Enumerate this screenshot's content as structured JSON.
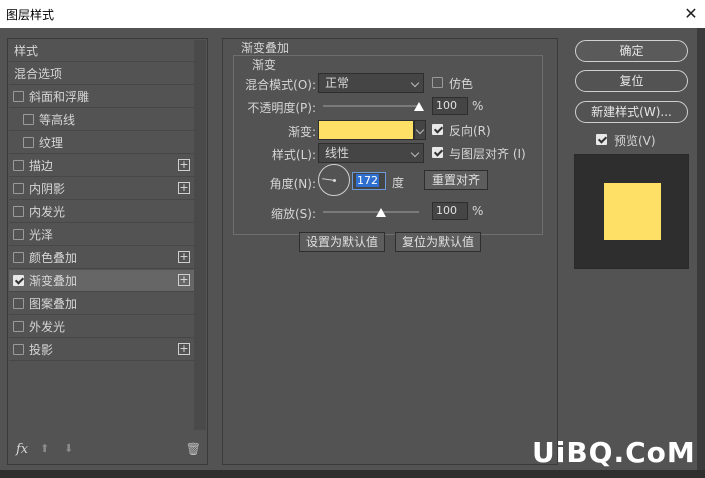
{
  "window": {
    "title": "图层样式",
    "close": "✕"
  },
  "styles_list": {
    "items": [
      {
        "label": "样式",
        "checkbox": false,
        "checked": false,
        "indent": 0,
        "plus": false,
        "selected": false
      },
      {
        "label": "混合选项",
        "checkbox": false,
        "checked": false,
        "indent": 0,
        "plus": false,
        "selected": false
      },
      {
        "label": "斜面和浮雕",
        "checkbox": true,
        "checked": false,
        "indent": 0,
        "plus": false,
        "selected": false
      },
      {
        "label": "等高线",
        "checkbox": true,
        "checked": false,
        "indent": 1,
        "plus": false,
        "selected": false
      },
      {
        "label": "纹理",
        "checkbox": true,
        "checked": false,
        "indent": 1,
        "plus": false,
        "selected": false
      },
      {
        "label": "描边",
        "checkbox": true,
        "checked": false,
        "indent": 0,
        "plus": true,
        "selected": false
      },
      {
        "label": "内阴影",
        "checkbox": true,
        "checked": false,
        "indent": 0,
        "plus": true,
        "selected": false
      },
      {
        "label": "内发光",
        "checkbox": true,
        "checked": false,
        "indent": 0,
        "plus": false,
        "selected": false
      },
      {
        "label": "光泽",
        "checkbox": true,
        "checked": false,
        "indent": 0,
        "plus": false,
        "selected": false
      },
      {
        "label": "颜色叠加",
        "checkbox": true,
        "checked": false,
        "indent": 0,
        "plus": true,
        "selected": false
      },
      {
        "label": "渐变叠加",
        "checkbox": true,
        "checked": true,
        "indent": 0,
        "plus": true,
        "selected": true
      },
      {
        "label": "图案叠加",
        "checkbox": true,
        "checked": false,
        "indent": 0,
        "plus": false,
        "selected": false
      },
      {
        "label": "外发光",
        "checkbox": true,
        "checked": false,
        "indent": 0,
        "plus": false,
        "selected": false
      },
      {
        "label": "投影",
        "checkbox": true,
        "checked": false,
        "indent": 0,
        "plus": true,
        "selected": false
      }
    ],
    "footer": {
      "fx": "fx",
      "up": "⬆",
      "down": "⬇",
      "trash": "🗑"
    }
  },
  "gradient_overlay": {
    "group_title": "渐变叠加",
    "sub_title": "渐变",
    "blend_mode_label": "混合模式(O):",
    "blend_mode_value": "正常",
    "dither_label": "仿色",
    "dither_checked": false,
    "opacity_label": "不透明度(P):",
    "opacity_value": "100",
    "opacity_unit": "%",
    "opacity_level": 1.0,
    "gradient_label": "渐变:",
    "gradient_color": "#ffe066",
    "reverse_label": "反向(R)",
    "reverse_checked": true,
    "style_label": "样式(L):",
    "style_value": "线性",
    "align_label": "与图层对齐 (I)",
    "align_checked": true,
    "angle_label": "角度(N):",
    "angle_value": "172",
    "angle_unit": "度",
    "reset_align_button": "重置对齐",
    "scale_label": "缩放(S):",
    "scale_value": "100",
    "scale_unit": "%",
    "scale_level": 0.6,
    "set_default_button": "设置为默认值",
    "reset_default_button": "复位为默认值"
  },
  "actions": {
    "ok": "确定",
    "reset": "复位",
    "new_style": "新建样式(W)...",
    "preview_label": "预览(V)",
    "preview_checked": true
  },
  "preview": {
    "swatch_color": "#ffe066"
  },
  "watermark": "UiBQ.CoM"
}
